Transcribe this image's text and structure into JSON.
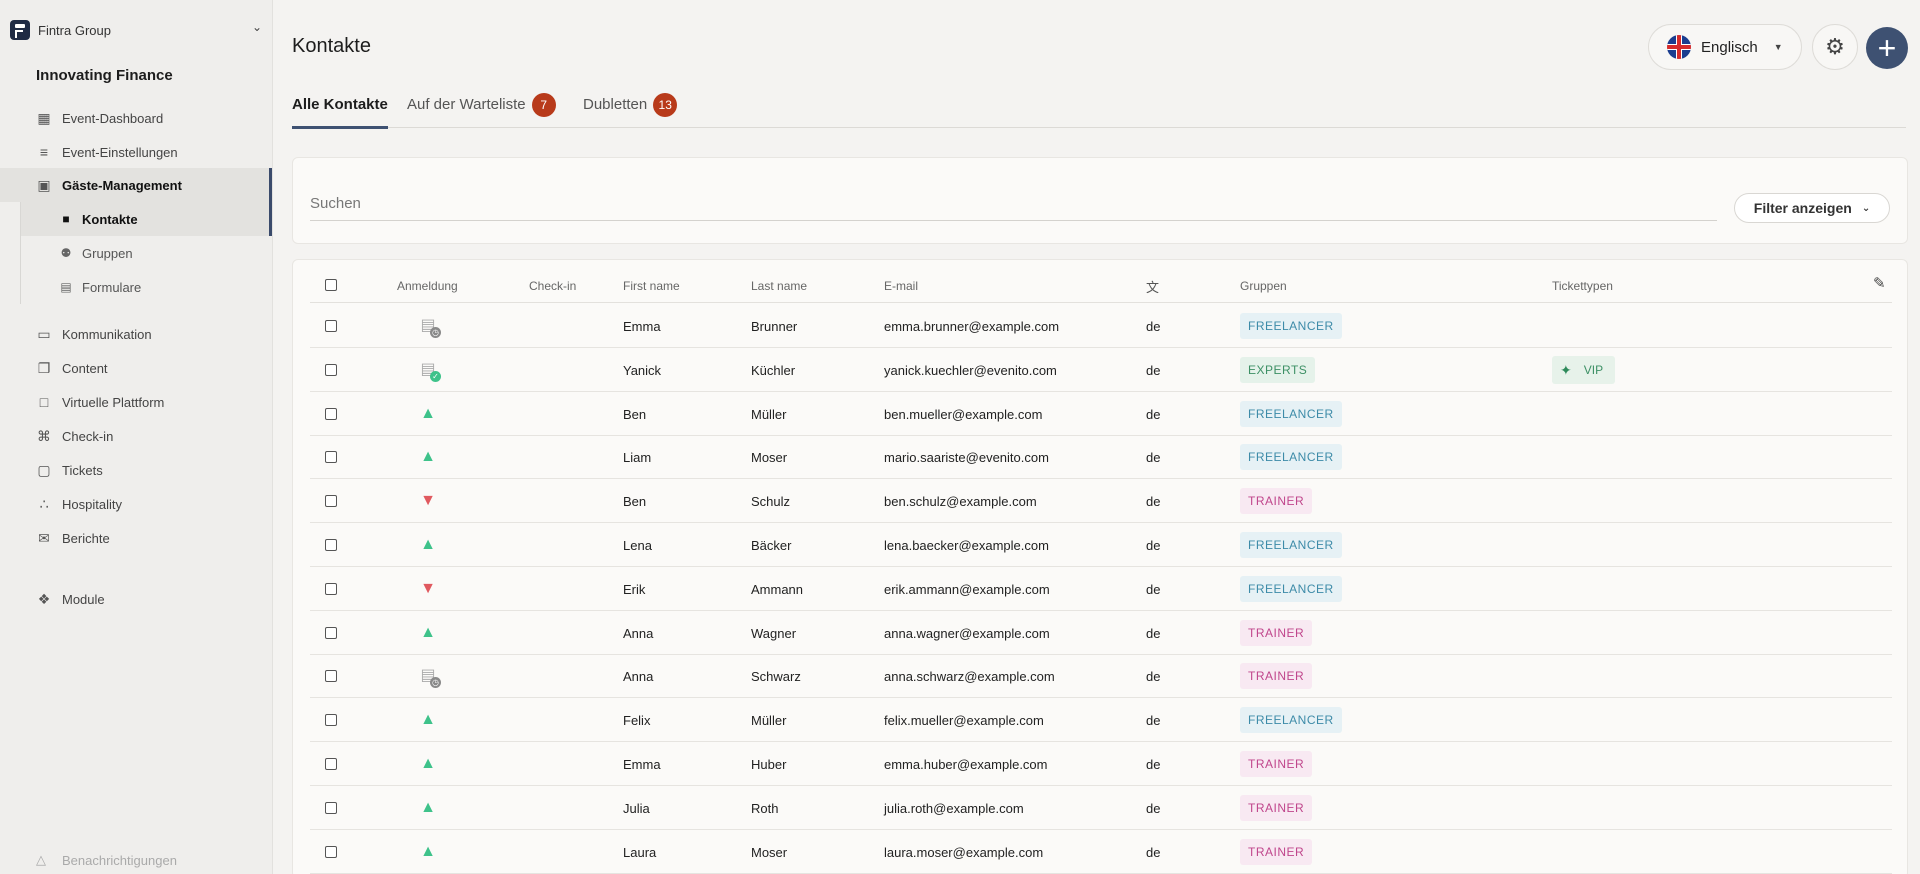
{
  "sidebar": {
    "org_name": "Fintra Group",
    "project_name": "Innovating Finance",
    "nav": [
      {
        "label": "Event-Dashboard",
        "icon": "dashboard-icon"
      },
      {
        "label": "Event-Einstellungen",
        "icon": "sliders-icon"
      },
      {
        "label": "Gäste-Management",
        "icon": "id-card-icon"
      }
    ],
    "sub_nav": [
      {
        "label": "Kontakte",
        "icon": "contact-icon"
      },
      {
        "label": "Gruppen",
        "icon": "group-icon"
      },
      {
        "label": "Formulare",
        "icon": "form-icon"
      }
    ],
    "nav2": [
      {
        "label": "Kommunikation",
        "icon": "chat-icon"
      },
      {
        "label": "Content",
        "icon": "documents-icon"
      },
      {
        "label": "Virtuelle Plattform",
        "icon": "monitor-icon"
      },
      {
        "label": "Check-in",
        "icon": "qr-scan-icon"
      },
      {
        "label": "Tickets",
        "icon": "ticket-icon"
      },
      {
        "label": "Hospitality",
        "icon": "hierarchy-icon"
      },
      {
        "label": "Berichte",
        "icon": "report-icon"
      }
    ],
    "modules_label": "Module",
    "notifications_label": "Benachrichtigungen"
  },
  "header": {
    "title": "Kontakte",
    "language": "Englisch"
  },
  "tabs": [
    {
      "label": "Alle Kontakte"
    },
    {
      "label": "Auf der Warteliste",
      "badge": "7"
    },
    {
      "label": "Dubletten",
      "badge": "13"
    }
  ],
  "search": {
    "placeholder": "Suchen",
    "filter_label": "Filter anzeigen"
  },
  "table": {
    "columns": {
      "registration": "Anmeldung",
      "checkin": "Check-in",
      "first_name": "First name",
      "last_name": "Last name",
      "email": "E-mail",
      "groups": "Gruppen",
      "ticket_types": "Tickettypen"
    },
    "rows": [
      {
        "status": "pending",
        "first": "Emma",
        "last": "Brunner",
        "email": "emma.brunner@example.com",
        "lang": "de",
        "group": "FREELANCER",
        "ticket": ""
      },
      {
        "status": "confirmed",
        "first": "Yanick",
        "last": "Küchler",
        "email": "yanick.kuechler@evenito.com",
        "lang": "de",
        "group": "EXPERTS",
        "ticket": "VIP"
      },
      {
        "status": "up",
        "first": "Ben",
        "last": "Müller",
        "email": "ben.mueller@example.com",
        "lang": "de",
        "group": "FREELANCER",
        "ticket": ""
      },
      {
        "status": "up",
        "first": "Liam",
        "last": "Moser",
        "email": "mario.saariste@evenito.com",
        "lang": "de",
        "group": "FREELANCER",
        "ticket": ""
      },
      {
        "status": "down",
        "first": "Ben",
        "last": "Schulz",
        "email": "ben.schulz@example.com",
        "lang": "de",
        "group": "TRAINER",
        "ticket": ""
      },
      {
        "status": "up",
        "first": "Lena",
        "last": "Bäcker",
        "email": "lena.baecker@example.com",
        "lang": "de",
        "group": "FREELANCER",
        "ticket": ""
      },
      {
        "status": "down",
        "first": "Erik",
        "last": "Ammann",
        "email": "erik.ammann@example.com",
        "lang": "de",
        "group": "FREELANCER",
        "ticket": ""
      },
      {
        "status": "up",
        "first": "Anna",
        "last": "Wagner",
        "email": "anna.wagner@example.com",
        "lang": "de",
        "group": "TRAINER",
        "ticket": ""
      },
      {
        "status": "pending",
        "first": "Anna",
        "last": "Schwarz",
        "email": "anna.schwarz@example.com",
        "lang": "de",
        "group": "TRAINER",
        "ticket": ""
      },
      {
        "status": "up",
        "first": "Felix",
        "last": "Müller",
        "email": "felix.mueller@example.com",
        "lang": "de",
        "group": "FREELANCER",
        "ticket": ""
      },
      {
        "status": "up",
        "first": "Emma",
        "last": "Huber",
        "email": "emma.huber@example.com",
        "lang": "de",
        "group": "TRAINER",
        "ticket": ""
      },
      {
        "status": "up",
        "first": "Julia",
        "last": "Roth",
        "email": "julia.roth@example.com",
        "lang": "de",
        "group": "TRAINER",
        "ticket": ""
      },
      {
        "status": "up",
        "first": "Laura",
        "last": "Moser",
        "email": "laura.moser@example.com",
        "lang": "de",
        "group": "TRAINER",
        "ticket": ""
      }
    ]
  }
}
